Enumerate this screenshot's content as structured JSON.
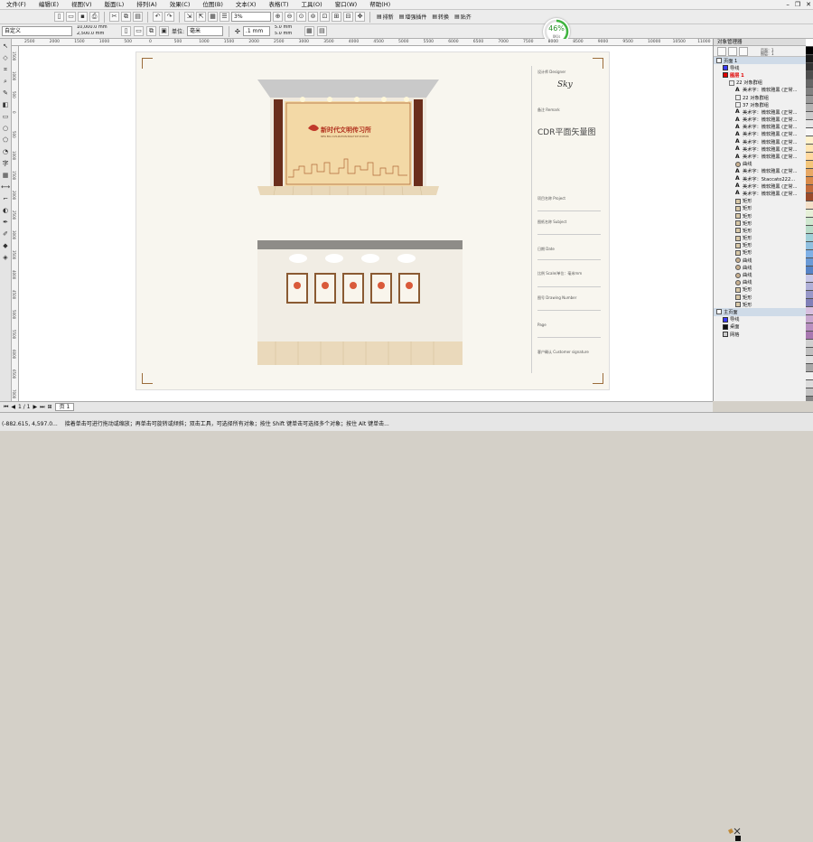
{
  "menu": [
    "文件(F)",
    "编辑(E)",
    "视图(V)",
    "版面(L)",
    "排列(A)",
    "效果(C)",
    "位图(B)",
    "文本(X)",
    "表格(T)",
    "工具(O)",
    "窗口(W)",
    "帮助(H)"
  ],
  "toolbar1": {
    "zoom": "3%",
    "text_buttons": [
      "排新",
      "增强插件",
      "转换",
      "贴齐"
    ]
  },
  "toolbar2": {
    "preset": "自定义",
    "width": "10,000.0 mm",
    "height": "2,500.0 mm",
    "units_label": "单位:",
    "units": "毫米",
    "nudge": ".1 mm",
    "dup_x": "5.0 mm",
    "dup_y": "5.0 mm"
  },
  "progress": {
    "value": "46%",
    "rate": "0K/s",
    "fraction": 0.46
  },
  "ruler": {
    "h": [
      "2500",
      "2000",
      "1500",
      "1000",
      "500",
      "0",
      "500",
      "1000",
      "1500",
      "2000",
      "2500",
      "3000",
      "3500",
      "4000",
      "4500",
      "5000",
      "5500",
      "6000",
      "6500",
      "7000",
      "7500",
      "8000",
      "8500",
      "9000",
      "9500",
      "10000",
      "10500",
      "11000",
      "11500",
      "12000"
    ],
    "v": [
      "1500",
      "1000",
      "500",
      "0",
      "500",
      "1000",
      "1500",
      "2000",
      "2500",
      "3000",
      "3500",
      "4000",
      "4500",
      "5000",
      "5500",
      "6000",
      "6500",
      "7000"
    ]
  },
  "titleblock": {
    "designer": "设计师 Designer",
    "signature": "Sky",
    "remark": "备注 Remark",
    "cdr_title": "CDR平面矢量图",
    "project": "项目名称 Project",
    "subject": "图纸名称 Subject",
    "date": "日期 Date",
    "scale": "比例 Scale/单位：毫米mm",
    "drawing_number": "图号 Drawing Number",
    "page": "Page",
    "customer": "客户确认 Customer signature"
  },
  "signboard": {
    "title": "新时代文明传习所",
    "subtitle": "NEW ERA CIVILIZATION PRACTICE STATION"
  },
  "object_manager": {
    "title": "对象管理器",
    "layer_label": [
      "页面：1",
      "图层：1"
    ],
    "rows": [
      {
        "label": "页面 1",
        "indent": 0,
        "kind": "group",
        "color": ""
      },
      {
        "label": "导线",
        "indent": 1,
        "kind": "layer",
        "color": "#3b3bff"
      },
      {
        "label": "图层 1",
        "indent": 1,
        "kind": "layer-active",
        "color": "#e00000"
      },
      {
        "label": "22 对象群组",
        "indent": 2,
        "kind": "obj",
        "color": ""
      },
      {
        "label": "美术字：微软雅黑 (正常...",
        "indent": 3,
        "kind": "text",
        "color": ""
      },
      {
        "label": "22 对象群组",
        "indent": 3,
        "kind": "obj",
        "color": ""
      },
      {
        "label": "37 对象群组",
        "indent": 3,
        "kind": "obj",
        "color": ""
      },
      {
        "label": "美术字：微软雅黑 (正常...",
        "indent": 3,
        "kind": "text",
        "color": ""
      },
      {
        "label": "美术字：微软雅黑 (正常...",
        "indent": 3,
        "kind": "text",
        "color": ""
      },
      {
        "label": "美术字：微软雅黑 (正常...",
        "indent": 3,
        "kind": "text",
        "color": ""
      },
      {
        "label": "美术字：微软雅黑 (正常...",
        "indent": 3,
        "kind": "text",
        "color": ""
      },
      {
        "label": "美术字：微软雅黑 (正常...",
        "indent": 3,
        "kind": "text",
        "color": ""
      },
      {
        "label": "美术字：微软雅黑 (正常...",
        "indent": 3,
        "kind": "text",
        "color": ""
      },
      {
        "label": "美术字：微软雅黑 (正常...",
        "indent": 3,
        "kind": "text",
        "color": ""
      },
      {
        "label": "曲线",
        "indent": 3,
        "kind": "curve",
        "color": ""
      },
      {
        "label": "美术字：微软雅黑 (正常...",
        "indent": 3,
        "kind": "text",
        "color": ""
      },
      {
        "label": "美术字：Staccato222...",
        "indent": 3,
        "kind": "text",
        "color": ""
      },
      {
        "label": "美术字：微软雅黑 (正常...",
        "indent": 3,
        "kind": "text",
        "color": ""
      },
      {
        "label": "美术字：微软雅黑 (正常...",
        "indent": 3,
        "kind": "text",
        "color": ""
      },
      {
        "label": "矩形",
        "indent": 3,
        "kind": "rect",
        "color": ""
      },
      {
        "label": "矩形",
        "indent": 3,
        "kind": "rect",
        "color": ""
      },
      {
        "label": "矩形",
        "indent": 3,
        "kind": "rect",
        "color": ""
      },
      {
        "label": "矩形",
        "indent": 3,
        "kind": "rect",
        "color": ""
      },
      {
        "label": "矩形",
        "indent": 3,
        "kind": "rect",
        "color": ""
      },
      {
        "label": "矩形",
        "indent": 3,
        "kind": "rect",
        "color": ""
      },
      {
        "label": "矩形",
        "indent": 3,
        "kind": "rect",
        "color": ""
      },
      {
        "label": "矩形",
        "indent": 3,
        "kind": "rect",
        "color": ""
      },
      {
        "label": "曲线",
        "indent": 3,
        "kind": "curve",
        "color": ""
      },
      {
        "label": "曲线",
        "indent": 3,
        "kind": "curve",
        "color": ""
      },
      {
        "label": "曲线",
        "indent": 3,
        "kind": "curve",
        "color": ""
      },
      {
        "label": "曲线",
        "indent": 3,
        "kind": "curve",
        "color": ""
      },
      {
        "label": "矩形",
        "indent": 3,
        "kind": "rect",
        "color": ""
      },
      {
        "label": "矩形",
        "indent": 3,
        "kind": "rect",
        "color": ""
      },
      {
        "label": "矩形",
        "indent": 3,
        "kind": "rect",
        "color": ""
      },
      {
        "label": "主页面",
        "indent": 0,
        "kind": "group",
        "color": ""
      },
      {
        "label": "导线",
        "indent": 1,
        "kind": "layer",
        "color": "#3b3bff"
      },
      {
        "label": "桌面",
        "indent": 1,
        "kind": "layer",
        "color": "#111111"
      },
      {
        "label": "网格",
        "indent": 1,
        "kind": "layer",
        "color": "#cccccc"
      }
    ]
  },
  "palette": [
    "#ffffff",
    "#000000",
    "#1a1a1a",
    "#333333",
    "#4d4d4d",
    "#666666",
    "#808080",
    "#999999",
    "#b3b3b3",
    "#cccccc",
    "#e6e6e6",
    "#f7f7f7",
    "#fff2cc",
    "#ffe6b3",
    "#ffd9a0",
    "#f4c67a",
    "#e8a965",
    "#d98b4a",
    "#c26b3a",
    "#9b4a2a",
    "#f4e0c8",
    "#e6f0d8",
    "#d0e8d0",
    "#b8dcc8",
    "#a0d0d8",
    "#90c0e0",
    "#7fb0e6",
    "#6a9ad6",
    "#5784c6",
    "#c8c8e8",
    "#b0b0d8",
    "#9898c8",
    "#8080b8",
    "#d8c0e0",
    "#c8a8d0",
    "#b890c0",
    "#a878b0",
    "#d0d0d0",
    "#bfbfbf",
    "#e0e0e0",
    "#a8a8a8",
    "#f0f0f0",
    "#dcdcdc",
    "#c4c4c4"
  ],
  "pagebar": {
    "count": "1 / 1",
    "tab": "页 1"
  },
  "status": {
    "coords": "(-882.615, 4,597.0...",
    "hint": "接着单击可进行拖动或缩放；再单击可旋转或倾斜；双击工具，可选择所有对象；按住 Shift 键单击可选择多个对象；按住 Alt 键单击..."
  }
}
